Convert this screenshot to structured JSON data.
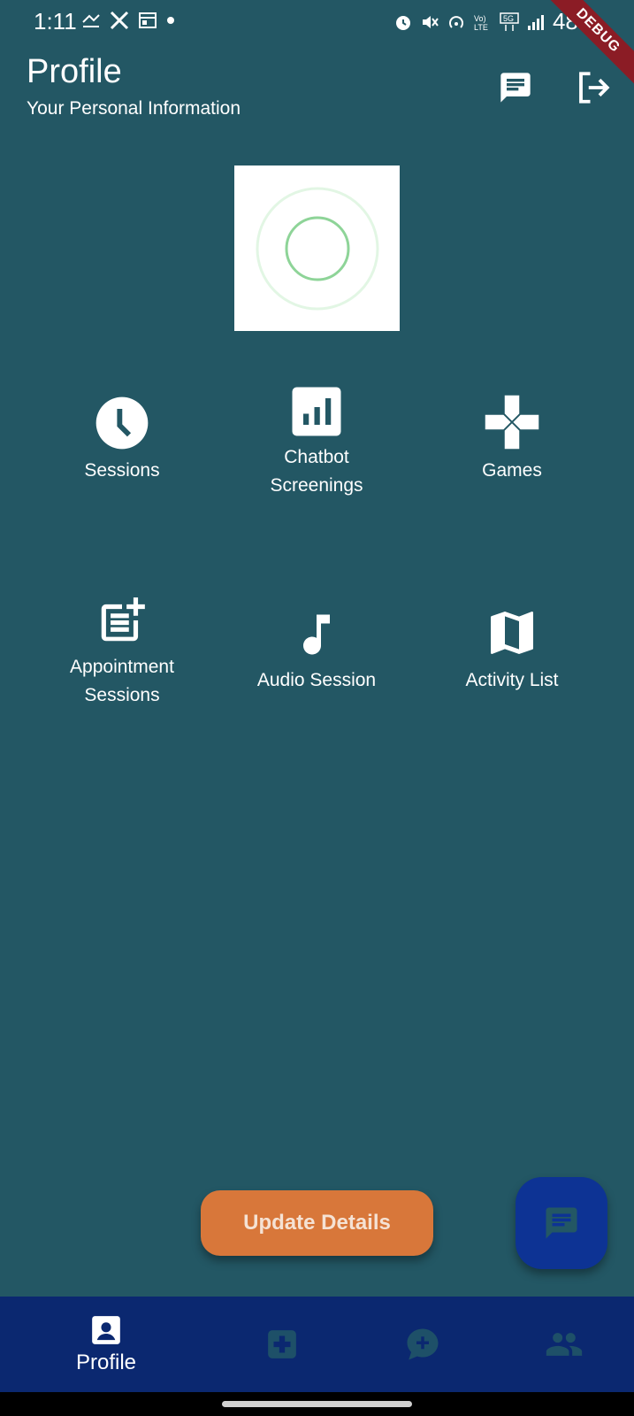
{
  "status_bar": {
    "time": "1:11",
    "battery": "48%",
    "left_icons": [
      "missed-call-icon",
      "x-app-icon",
      "calendar-icon",
      "dot-icon"
    ],
    "right_icons": [
      "alarm-icon",
      "mute-icon",
      "hotspot-icon",
      "volte-icon",
      "5g-icon",
      "signal-icon"
    ]
  },
  "debug_banner": "DEBUG",
  "header": {
    "title": "Profile",
    "subtitle": "Your Personal Information"
  },
  "menu": {
    "items": [
      {
        "label": "Sessions",
        "icon": "clock-icon"
      },
      {
        "label": "Chatbot Screenings",
        "icon": "bar-chart-icon"
      },
      {
        "label": "Games",
        "icon": "gamepad-icon"
      },
      {
        "label": "Appointment Sessions",
        "icon": "post-add-icon"
      },
      {
        "label": "Audio Session",
        "icon": "music-note-icon"
      },
      {
        "label": "Activity List",
        "icon": "map-icon"
      }
    ]
  },
  "update_button": {
    "label": "Update Details"
  },
  "bottom_nav": {
    "items": [
      {
        "label": "Profile",
        "icon": "profile-badge-icon",
        "active": true
      },
      {
        "label": "",
        "icon": "medical-plus-icon",
        "active": false
      },
      {
        "label": "",
        "icon": "chat-add-icon",
        "active": false
      },
      {
        "label": "",
        "icon": "people-icon",
        "active": false
      }
    ]
  },
  "colors": {
    "background": "#235764",
    "update_button": "#d8773a",
    "fab": "#0d3394",
    "bottom_nav": "#0b2870",
    "nav_inactive": "#1e5068",
    "debug": "#8b1c25"
  }
}
